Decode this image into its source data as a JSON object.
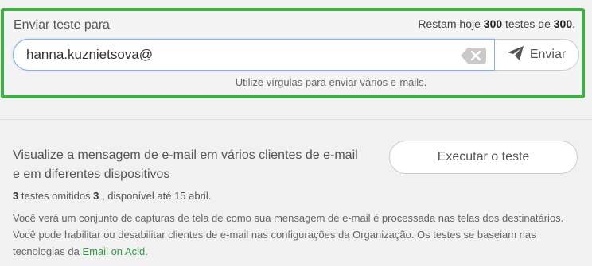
{
  "send_test": {
    "label": "Enviar teste para",
    "quota_prefix": "Restam hoje ",
    "quota_remaining": "300",
    "quota_middle": " testes de ",
    "quota_total": "300",
    "quota_suffix": ".",
    "email_value": "hanna.kuznietsova@",
    "send_button_label": "Enviar",
    "hint": "Utilize vírgulas para enviar vários e-mails."
  },
  "preview": {
    "title": "Visualize a mensagem de e-mail em vários clientes de e-mail e em diferentes dispositivos",
    "run_button_label": "Executar o teste",
    "omitted_count": "3",
    "omitted_text_1": " testes omitidos ",
    "omitted_count_2": "3",
    "omitted_text_2": " , disponível até 15 abril.",
    "description_text": "Você verá um conjunto de capturas de tela de como sua mensagem de e-mail é processada nas telas dos destinatários. Você pode habilitar ou desabilitar clientes de e-mail nas configurações da Organização. Os testes se baseiam nas tecnologias da ",
    "description_link": "Email on Acid",
    "description_end": "."
  },
  "colors": {
    "highlight_border": "#3cb043",
    "link": "#2e9b3a",
    "input_focus": "#7fb3ea"
  },
  "icons": {
    "clear": "backspace-clear-icon",
    "send": "paper-plane-icon"
  }
}
